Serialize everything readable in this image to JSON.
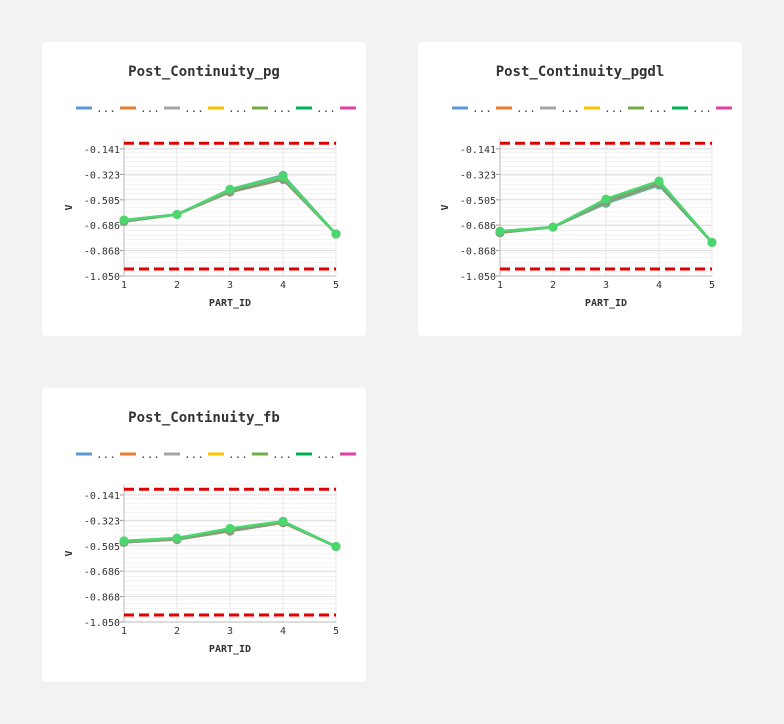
{
  "colors": {
    "limit": "#e00000",
    "trace": "#4cd66e",
    "trace_alt": [
      "#5fb59a",
      "#6fa87c",
      "#8c9a7a"
    ],
    "legend": [
      "#5b9bd5",
      "#ed7d31",
      "#a5a5a5",
      "#ffc000",
      "#70ad47",
      "#00b050",
      "#e040a0"
    ]
  },
  "legend_label": "...",
  "chart_data": [
    {
      "type": "line",
      "title": "Post_Continuity_pg",
      "xlabel": "PART_ID",
      "ylabel": "V",
      "x": [
        1,
        2,
        3,
        4,
        5
      ],
      "y_ticks": [
        "-0.141",
        "-0.323",
        "-0.505",
        "-0.686",
        "-0.868",
        "-1.050"
      ],
      "ylim": [
        -1.05,
        -0.141
      ],
      "limits": [
        -0.1,
        -1.0
      ],
      "grid": true,
      "legend_position": "top",
      "series": [
        {
          "values": [
            -0.66,
            -0.61,
            -0.43,
            -0.33,
            -0.75
          ]
        },
        {
          "values": [
            -0.65,
            -0.61,
            -0.44,
            -0.35,
            -0.75
          ]
        },
        {
          "values": [
            -0.66,
            -0.61,
            -0.45,
            -0.36,
            -0.75
          ]
        },
        {
          "values": [
            -0.65,
            -0.61,
            -0.43,
            -0.34,
            -0.75
          ]
        }
      ]
    },
    {
      "type": "line",
      "title": "Post_Continuity_pgdl",
      "xlabel": "PART_ID",
      "ylabel": "V",
      "x": [
        1,
        2,
        3,
        4,
        5
      ],
      "y_ticks": [
        "-0.141",
        "-0.323",
        "-0.505",
        "-0.686",
        "-0.868",
        "-1.050"
      ],
      "ylim": [
        -1.05,
        -0.141
      ],
      "limits": [
        -0.1,
        -1.0
      ],
      "grid": true,
      "legend_position": "top",
      "series": [
        {
          "values": [
            -0.74,
            -0.7,
            -0.53,
            -0.4,
            -0.81
          ]
        },
        {
          "values": [
            -0.73,
            -0.7,
            -0.51,
            -0.38,
            -0.81
          ]
        },
        {
          "values": [
            -0.74,
            -0.7,
            -0.52,
            -0.39,
            -0.81
          ]
        },
        {
          "values": [
            -0.73,
            -0.7,
            -0.5,
            -0.37,
            -0.81
          ]
        }
      ]
    },
    {
      "type": "line",
      "title": "Post_Continuity_fb",
      "xlabel": "PART_ID",
      "ylabel": "V",
      "x": [
        1,
        2,
        3,
        4,
        5
      ],
      "y_ticks": [
        "-0.141",
        "-0.323",
        "-0.505",
        "-0.686",
        "-0.868",
        "-1.050"
      ],
      "ylim": [
        -1.05,
        -0.141
      ],
      "limits": [
        -0.1,
        -1.0
      ],
      "grid": true,
      "legend_position": "top",
      "series": [
        {
          "values": [
            -0.48,
            -0.46,
            -0.39,
            -0.33,
            -0.51
          ]
        },
        {
          "values": [
            -0.47,
            -0.45,
            -0.39,
            -0.34,
            -0.51
          ]
        },
        {
          "values": [
            -0.48,
            -0.46,
            -0.4,
            -0.34,
            -0.51
          ]
        },
        {
          "values": [
            -0.47,
            -0.45,
            -0.38,
            -0.33,
            -0.51
          ]
        }
      ]
    }
  ]
}
